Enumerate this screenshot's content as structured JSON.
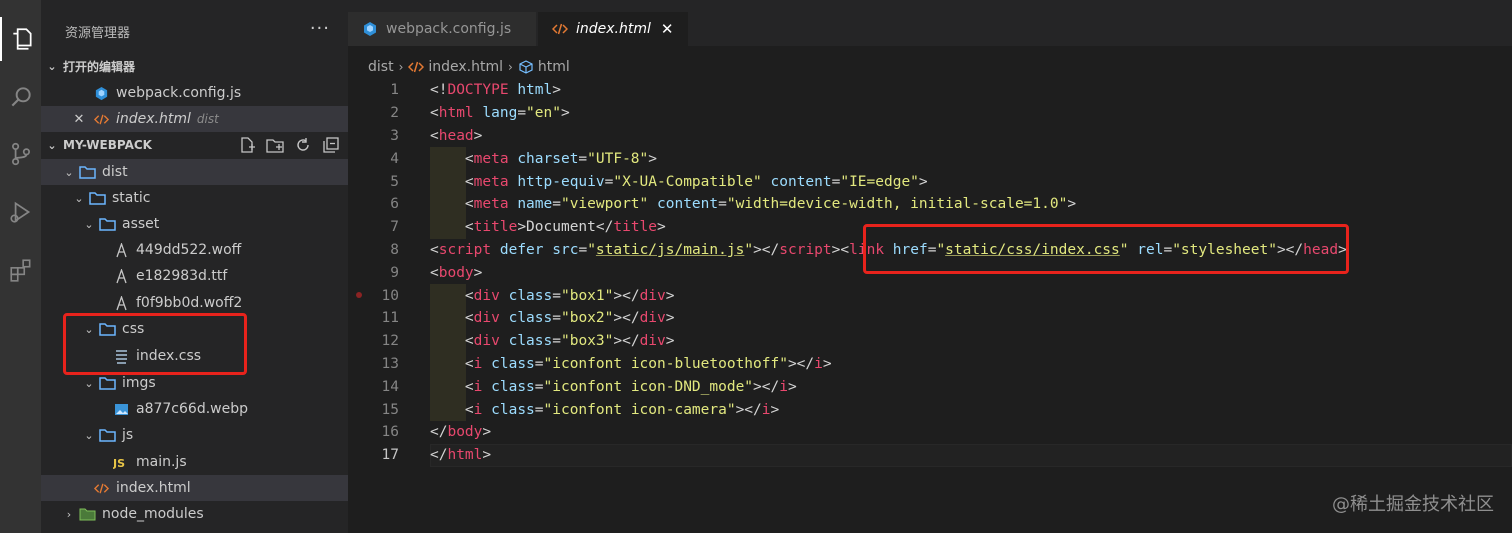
{
  "sidebar": {
    "title": "资源管理器",
    "more": "···",
    "open_editors_header": "打开的编辑器",
    "open_editors": [
      {
        "label": "webpack.config.js",
        "desc": ""
      },
      {
        "label": "index.html",
        "desc": "dist"
      }
    ],
    "project_header": "MY-WEBPACK",
    "tree": {
      "dist": "dist",
      "static": "static",
      "asset": "asset",
      "font1": "449dd522.woff",
      "font2": "e182983d.ttf",
      "font3": "f0f9bb0d.woff2",
      "css": "css",
      "css_file": "index.css",
      "imgs": "imgs",
      "img_file": "a877c66d.webp",
      "js": "js",
      "js_file": "main.js",
      "html_file": "index.html",
      "node_modules": "node_modules"
    }
  },
  "tabs": [
    {
      "label": "webpack.config.js",
      "active": false
    },
    {
      "label": "index.html",
      "active": true
    }
  ],
  "breadcrumb": [
    "dist",
    "index.html",
    "html"
  ],
  "editor": {
    "line_numbers": [
      "1",
      "2",
      "3",
      "4",
      "5",
      "6",
      "7",
      "8",
      "9",
      "10",
      "11",
      "12",
      "13",
      "14",
      "15",
      "16",
      "17"
    ],
    "current_line": 17
  },
  "watermark": "@稀土掘金技术社区",
  "colors": {
    "highlight_box": "#e8231c",
    "tag": "#e8486e",
    "attribute": "#9cdcfe",
    "string": "#e2e87f"
  }
}
